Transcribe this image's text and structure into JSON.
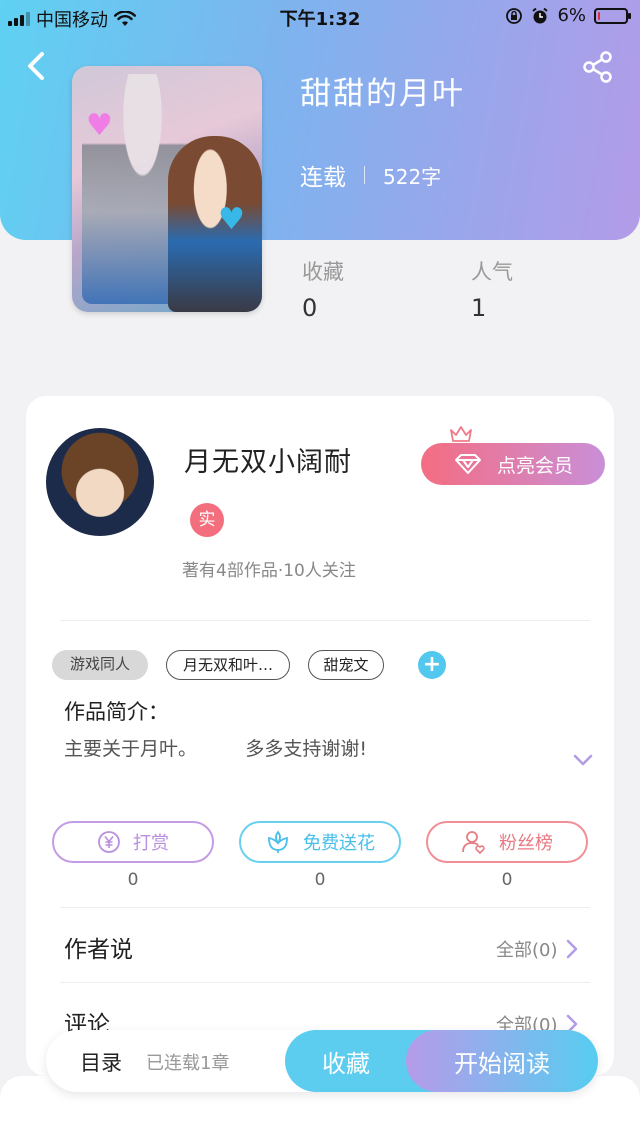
{
  "status_bar": {
    "carrier": "中国移动",
    "time": "下午1:32",
    "battery": "6%",
    "battery_level": 0.06
  },
  "book": {
    "title": "甜甜的月叶",
    "status": "连载",
    "word_count": "522字",
    "stats": [
      {
        "label": "收藏",
        "value": "0"
      },
      {
        "label": "人气",
        "value": "1"
      }
    ]
  },
  "author": {
    "name": "月无双小阔耐",
    "badge": "实",
    "summary": "著有4部作品·10人关注",
    "vip_label": "点亮会员"
  },
  "tags": [
    "游戏同人",
    "月无双和叶…",
    "甜宠文"
  ],
  "intro": {
    "label": "作品简介：",
    "text": "主要关于月叶。        多多支持谢谢!"
  },
  "actions": [
    {
      "label": "打赏",
      "count": "0",
      "icon": "yuan-icon"
    },
    {
      "label": "免费送花",
      "count": "0",
      "icon": "flower-icon"
    },
    {
      "label": "粉丝榜",
      "count": "0",
      "icon": "fan-icon"
    }
  ],
  "sections": [
    {
      "title": "作者说",
      "more": "全部(0)"
    },
    {
      "title": "评论",
      "more": "全部(0)"
    }
  ],
  "bottom_bar": {
    "toc_label": "目录",
    "toc_sub": "已连载1章",
    "favorite": "收藏",
    "start_reading": "开始阅读"
  },
  "colors": {
    "accent_blue": "#5ccdef",
    "accent_purple": "#b59be9",
    "accent_pink": "#f46d82"
  }
}
